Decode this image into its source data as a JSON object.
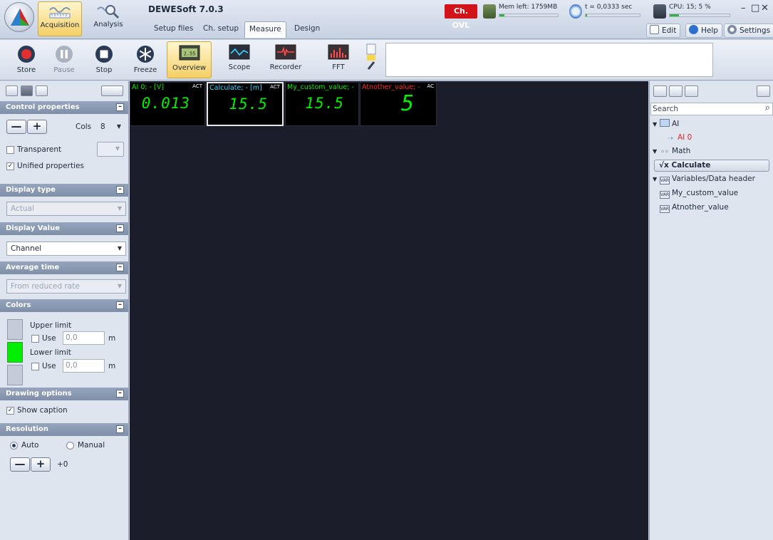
{
  "app": {
    "title": "DEWESoft 7.0.3",
    "modes": [
      {
        "label": "Acquisition",
        "active": true
      },
      {
        "label": "Analysis",
        "active": false
      }
    ],
    "tabs": [
      {
        "label": "Setup files"
      },
      {
        "label": "Ch. setup"
      },
      {
        "label": "Measure",
        "active": true
      },
      {
        "label": "Design"
      }
    ]
  },
  "status": {
    "overload_label": "Ch. OVL",
    "memory_label": "Mem left: 1759MB",
    "memory_fill_percent": 8,
    "time_label": "t = 0,0333 sec",
    "time_fill_percent": 3,
    "cpu_label": "CPU: 15; 5 %",
    "cpu_fill_percent": 15
  },
  "top_buttons": {
    "edit": "Edit",
    "help": "Help",
    "settings": "Settings"
  },
  "window_controls": {
    "minimize": "–",
    "maximize": "□",
    "close": "✕"
  },
  "toolbar": {
    "store": "Store",
    "pause": "Pause",
    "stop": "Stop",
    "freeze": "Freeze",
    "overview": "Overview",
    "scope": "Scope",
    "recorder": "Recorder",
    "fft": "FFT",
    "overview_icon_text": "2.55"
  },
  "left_panel": {
    "control_properties": {
      "header": "Control properties",
      "minus": "—",
      "plus": "+",
      "cols_label": "Cols",
      "cols_value": "8",
      "transparent_label": "Transparent",
      "transparent_checked": false,
      "unified_label": "Unified properties",
      "unified_checked": true
    },
    "display_type": {
      "header": "Display type",
      "value": "Actual"
    },
    "display_value": {
      "header": "Display Value",
      "value": "Channel"
    },
    "average_time": {
      "header": "Average time",
      "value": "From reduced rate"
    },
    "colors": {
      "header": "Colors",
      "upper_limit_label": "Upper limit",
      "upper_use_label": "Use",
      "upper_value": "0,0",
      "upper_unit": "m",
      "lower_limit_label": "Lower limit",
      "lower_use_label": "Use",
      "lower_value": "0,0",
      "lower_unit": "m",
      "mid_swatch_color": "#00ee00"
    },
    "drawing_options": {
      "header": "Drawing options",
      "show_caption_label": "Show caption",
      "show_caption_checked": true
    },
    "resolution": {
      "header": "Resolution",
      "auto_label": "Auto",
      "manual_label": "Manual",
      "selected": "Auto",
      "minus": "—",
      "plus": "+",
      "offset": "+0"
    }
  },
  "instruments": [
    {
      "caption": "AI 0; - [V]",
      "caption_color": "#00ee00",
      "act": "ACT",
      "value": "0.013"
    },
    {
      "caption": "Calculate; - [m]",
      "caption_color": "#36d4ff",
      "act": "ACT",
      "value": "15.5"
    },
    {
      "caption": "My_custom_value; -",
      "caption_color": "#00ee00",
      "act": "",
      "value": "15.5"
    },
    {
      "caption": "Atnother_value; -",
      "caption_color": "#ff2a2a",
      "act": "AC",
      "value": "5"
    }
  ],
  "right_panel": {
    "search_placeholder": "Search",
    "tree": {
      "ai_group": "AI",
      "ai0": "AI 0",
      "math_group": "Math",
      "calculate": "Calculate",
      "variables_group": "Variables/Data header",
      "var1": "My_custom_value",
      "var2": "Atnother_value"
    }
  }
}
